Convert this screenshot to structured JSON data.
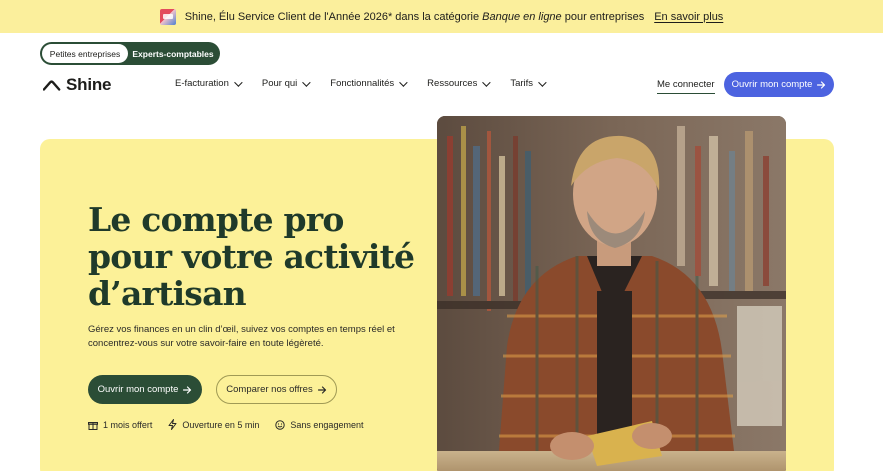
{
  "banner": {
    "text_before": "Shine, Élu Service Client de l'Année 2026* dans la catégorie ",
    "text_italic": "Banque en ligne",
    "text_after": " pour entreprises",
    "link": "En savoir plus",
    "badge_icon": "award-badge-icon"
  },
  "segment": {
    "options": [
      "Petites entreprises",
      "Experts-comptables"
    ],
    "selected": "Petites entreprises"
  },
  "nav": {
    "logo": "Shine",
    "items": [
      {
        "label": "E-facturation"
      },
      {
        "label": "Pour qui"
      },
      {
        "label": "Fonctionnalités"
      },
      {
        "label": "Ressources"
      },
      {
        "label": "Tarifs"
      }
    ],
    "login": "Me connecter",
    "open_account": "Ouvrir mon compte"
  },
  "hero": {
    "headline": "Le compte pro pour votre activité d’artisan",
    "subtitle": "Gérez vos finances en un clin d’œil, suivez vos comptes en temps réel et concentrez-vous sur votre savoir-faire en toute légèreté.",
    "cta_primary": "Ouvrir mon compte",
    "cta_secondary": "Comparer nos offres",
    "features": [
      {
        "label": "1 mois offert",
        "icon": "gift-icon"
      },
      {
        "label": "Ouverture en 5 min",
        "icon": "lightning-icon"
      },
      {
        "label": "Sans engagement",
        "icon": "smile-icon"
      }
    ]
  },
  "colors": {
    "banner_bg": "#fbef9c",
    "hero_bg": "#fcf198",
    "brand_green": "#2b4d36",
    "primary_blue": "#4c63e0"
  }
}
